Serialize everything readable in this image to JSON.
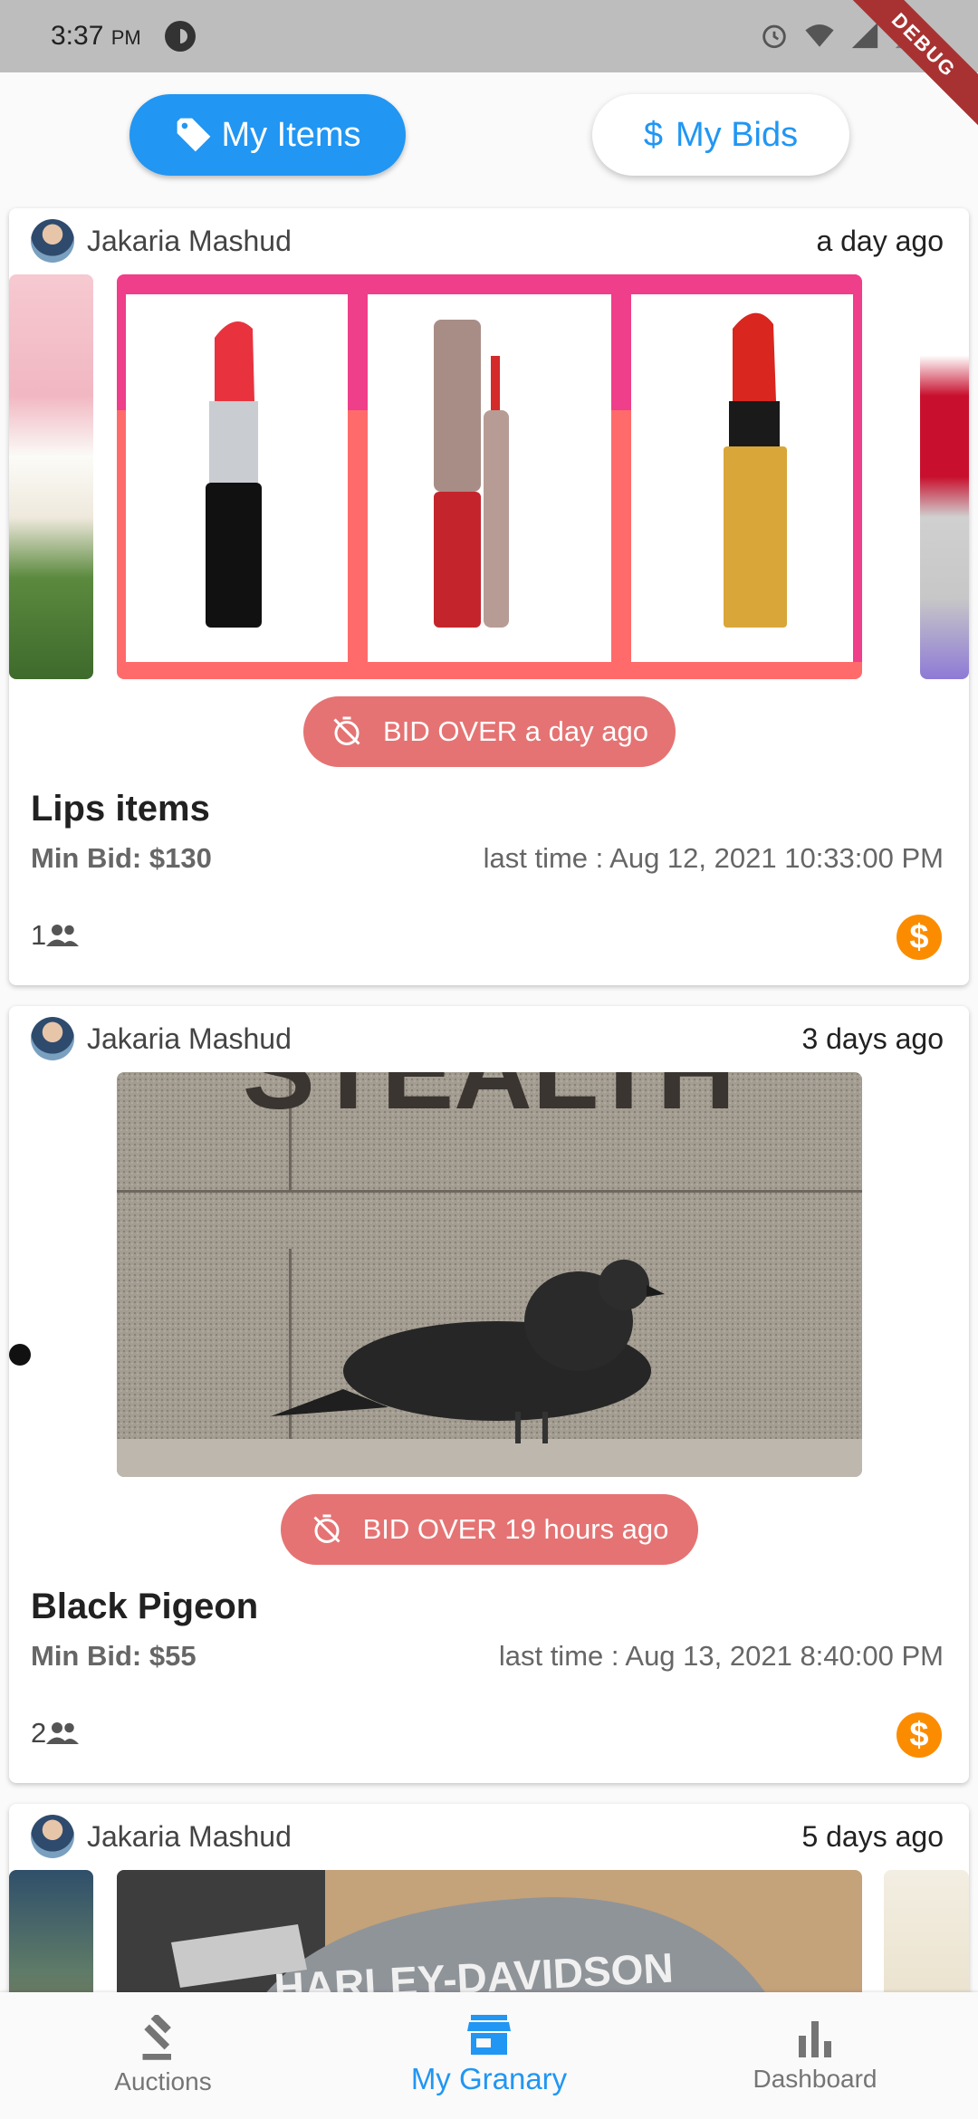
{
  "status_bar": {
    "time": "3:37",
    "ampm": "PM",
    "debug_banner": "DEBUG"
  },
  "tabs": {
    "my_items": "My Items",
    "my_bids": "My Bids",
    "active": "my_items"
  },
  "cards": [
    {
      "owner": "Jakaria Mashud",
      "posted": "a day ago",
      "bid_status": "BID OVER a day ago",
      "title": "Lips items",
      "min_bid": "Min Bid: $130",
      "last_time": "last time : Aug 12, 2021 10:33:00 PM",
      "bidders": "1"
    },
    {
      "owner": "Jakaria Mashud",
      "posted": "3 days ago",
      "bid_status": "BID OVER 19 hours ago",
      "title": "Black Pigeon",
      "min_bid": "Min Bid: $55",
      "last_time": "last time : Aug 13, 2021 8:40:00 PM",
      "bidders": "2"
    },
    {
      "owner": "Jakaria Mashud",
      "posted": "5 days ago"
    }
  ],
  "image_text": {
    "pigeon_wall": "STEALTH",
    "moto_tank": "HARLEY-DAVIDSON"
  },
  "bottom_nav": [
    {
      "label": "Auctions",
      "icon": "gavel-icon"
    },
    {
      "label": "My Granary",
      "icon": "store-icon",
      "active": true
    },
    {
      "label": "Dashboard",
      "icon": "bar-chart-icon"
    }
  ],
  "colors": {
    "primary": "#2196f3",
    "bid_over": "#e57373",
    "dollar": "#fb8c00",
    "status_bar": "#bdbdbd"
  }
}
